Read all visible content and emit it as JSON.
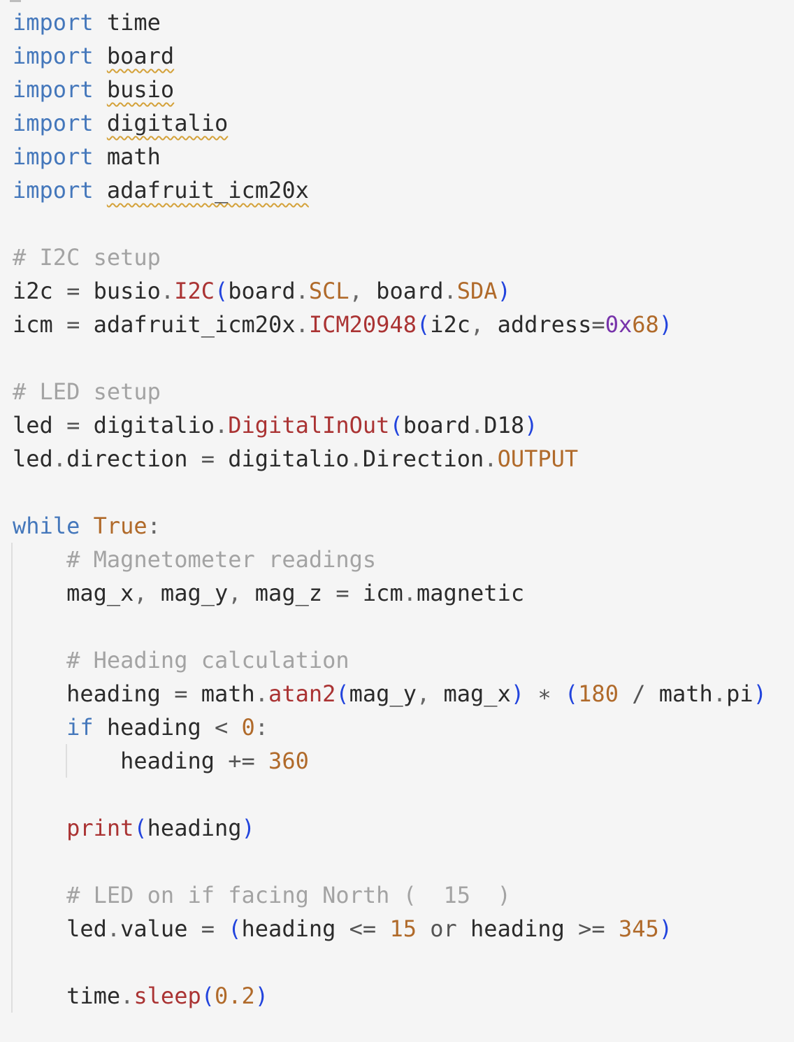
{
  "editor": {
    "language": "python",
    "colors": {
      "background": "#f5f5f5",
      "keyword": "#4477bb",
      "comment": "#a3a3a3",
      "attribute": "#b06a2a",
      "function": "#aa3333",
      "paren": "#2244dd",
      "number": "#b06a2a",
      "hex_prefix": "#7733aa",
      "squiggle_warning": "#d4a23a"
    },
    "lines": [
      {
        "tokens": [
          {
            "t": "import",
            "k": "kw"
          },
          {
            "t": " ",
            "k": "ident"
          },
          {
            "t": "time",
            "k": "ident"
          }
        ]
      },
      {
        "tokens": [
          {
            "t": "import",
            "k": "kw"
          },
          {
            "t": " ",
            "k": "ident"
          },
          {
            "t": "board",
            "k": "ident",
            "squig": true
          }
        ]
      },
      {
        "tokens": [
          {
            "t": "import",
            "k": "kw"
          },
          {
            "t": " ",
            "k": "ident"
          },
          {
            "t": "busio",
            "k": "ident",
            "squig": true
          }
        ]
      },
      {
        "tokens": [
          {
            "t": "import",
            "k": "kw"
          },
          {
            "t": " ",
            "k": "ident"
          },
          {
            "t": "digitalio",
            "k": "ident",
            "squig": true
          }
        ]
      },
      {
        "tokens": [
          {
            "t": "import",
            "k": "kw"
          },
          {
            "t": " ",
            "k": "ident"
          },
          {
            "t": "math",
            "k": "ident"
          }
        ]
      },
      {
        "tokens": [
          {
            "t": "import",
            "k": "kw"
          },
          {
            "t": " ",
            "k": "ident"
          },
          {
            "t": "adafruit_icm20x",
            "k": "ident",
            "squig": true
          }
        ]
      },
      {
        "tokens": []
      },
      {
        "tokens": [
          {
            "t": "# I2C setup",
            "k": "com"
          }
        ]
      },
      {
        "tokens": [
          {
            "t": "i2c ",
            "k": "ident"
          },
          {
            "t": "=",
            "k": "op"
          },
          {
            "t": " busio",
            "k": "ident"
          },
          {
            "t": ".",
            "k": "punc"
          },
          {
            "t": "I2C",
            "k": "func"
          },
          {
            "t": "(",
            "k": "paren"
          },
          {
            "t": "board",
            "k": "ident"
          },
          {
            "t": ".",
            "k": "punc"
          },
          {
            "t": "SCL",
            "k": "attr"
          },
          {
            "t": ", ",
            "k": "punc"
          },
          {
            "t": "board",
            "k": "ident"
          },
          {
            "t": ".",
            "k": "punc"
          },
          {
            "t": "SDA",
            "k": "attr"
          },
          {
            "t": ")",
            "k": "paren"
          }
        ]
      },
      {
        "tokens": [
          {
            "t": "icm ",
            "k": "ident"
          },
          {
            "t": "=",
            "k": "op"
          },
          {
            "t": " adafruit_icm20x",
            "k": "ident"
          },
          {
            "t": ".",
            "k": "punc"
          },
          {
            "t": "ICM20948",
            "k": "func"
          },
          {
            "t": "(",
            "k": "paren"
          },
          {
            "t": "i2c",
            "k": "ident"
          },
          {
            "t": ", ",
            "k": "punc"
          },
          {
            "t": "address",
            "k": "ident"
          },
          {
            "t": "=",
            "k": "op"
          },
          {
            "t": "0x",
            "k": "hex"
          },
          {
            "t": "68",
            "k": "num"
          },
          {
            "t": ")",
            "k": "paren"
          }
        ]
      },
      {
        "tokens": []
      },
      {
        "tokens": [
          {
            "t": "# LED setup",
            "k": "com"
          }
        ]
      },
      {
        "tokens": [
          {
            "t": "led ",
            "k": "ident"
          },
          {
            "t": "=",
            "k": "op"
          },
          {
            "t": " digitalio",
            "k": "ident"
          },
          {
            "t": ".",
            "k": "punc"
          },
          {
            "t": "DigitalInOut",
            "k": "func"
          },
          {
            "t": "(",
            "k": "paren"
          },
          {
            "t": "board",
            "k": "ident"
          },
          {
            "t": ".",
            "k": "punc"
          },
          {
            "t": "D18",
            "k": "ident"
          },
          {
            "t": ")",
            "k": "paren"
          }
        ]
      },
      {
        "tokens": [
          {
            "t": "led",
            "k": "ident"
          },
          {
            "t": ".",
            "k": "punc"
          },
          {
            "t": "direction ",
            "k": "ident"
          },
          {
            "t": "=",
            "k": "op"
          },
          {
            "t": " digitalio",
            "k": "ident"
          },
          {
            "t": ".",
            "k": "punc"
          },
          {
            "t": "Direction",
            "k": "ident"
          },
          {
            "t": ".",
            "k": "punc"
          },
          {
            "t": "OUTPUT",
            "k": "attr"
          }
        ]
      },
      {
        "tokens": []
      },
      {
        "tokens": [
          {
            "t": "while",
            "k": "kw"
          },
          {
            "t": " ",
            "k": "ident"
          },
          {
            "t": "True",
            "k": "attr"
          },
          {
            "t": ":",
            "k": "punc"
          }
        ]
      },
      {
        "tokens": [
          {
            "t": "    ",
            "k": "ident"
          },
          {
            "t": "# Magnetometer readings",
            "k": "com"
          }
        ]
      },
      {
        "tokens": [
          {
            "t": "    mag_x",
            "k": "ident"
          },
          {
            "t": ", ",
            "k": "punc"
          },
          {
            "t": "mag_y",
            "k": "ident"
          },
          {
            "t": ", ",
            "k": "punc"
          },
          {
            "t": "mag_z ",
            "k": "ident"
          },
          {
            "t": "=",
            "k": "op"
          },
          {
            "t": " icm",
            "k": "ident"
          },
          {
            "t": ".",
            "k": "punc"
          },
          {
            "t": "magnetic",
            "k": "ident"
          }
        ]
      },
      {
        "tokens": []
      },
      {
        "tokens": [
          {
            "t": "    ",
            "k": "ident"
          },
          {
            "t": "# Heading calculation",
            "k": "com"
          }
        ]
      },
      {
        "tokens": [
          {
            "t": "    heading ",
            "k": "ident"
          },
          {
            "t": "=",
            "k": "op"
          },
          {
            "t": " math",
            "k": "ident"
          },
          {
            "t": ".",
            "k": "punc"
          },
          {
            "t": "atan2",
            "k": "func"
          },
          {
            "t": "(",
            "k": "paren"
          },
          {
            "t": "mag_y",
            "k": "ident"
          },
          {
            "t": ", ",
            "k": "punc"
          },
          {
            "t": "mag_x",
            "k": "ident"
          },
          {
            "t": ")",
            "k": "paren"
          },
          {
            "t": " ∗ ",
            "k": "op"
          },
          {
            "t": "(",
            "k": "paren"
          },
          {
            "t": "180",
            "k": "num"
          },
          {
            "t": " / ",
            "k": "op"
          },
          {
            "t": "math",
            "k": "ident"
          },
          {
            "t": ".",
            "k": "punc"
          },
          {
            "t": "pi",
            "k": "ident"
          },
          {
            "t": ")",
            "k": "paren"
          }
        ]
      },
      {
        "tokens": [
          {
            "t": "    ",
            "k": "ident"
          },
          {
            "t": "if",
            "k": "kw"
          },
          {
            "t": " heading ",
            "k": "ident"
          },
          {
            "t": "<",
            "k": "op"
          },
          {
            "t": " ",
            "k": "ident"
          },
          {
            "t": "0",
            "k": "num"
          },
          {
            "t": ":",
            "k": "punc"
          }
        ]
      },
      {
        "tokens": [
          {
            "t": "        heading ",
            "k": "ident"
          },
          {
            "t": "+=",
            "k": "op"
          },
          {
            "t": " ",
            "k": "ident"
          },
          {
            "t": "360",
            "k": "num"
          }
        ]
      },
      {
        "tokens": []
      },
      {
        "tokens": [
          {
            "t": "    ",
            "k": "ident"
          },
          {
            "t": "print",
            "k": "func"
          },
          {
            "t": "(",
            "k": "paren"
          },
          {
            "t": "heading",
            "k": "ident"
          },
          {
            "t": ")",
            "k": "paren"
          }
        ]
      },
      {
        "tokens": []
      },
      {
        "tokens": [
          {
            "t": "    ",
            "k": "ident"
          },
          {
            "t": "# LED on if facing North (  15  )",
            "k": "com"
          }
        ]
      },
      {
        "tokens": [
          {
            "t": "    led",
            "k": "ident"
          },
          {
            "t": ".",
            "k": "punc"
          },
          {
            "t": "value ",
            "k": "ident"
          },
          {
            "t": "=",
            "k": "op"
          },
          {
            "t": " ",
            "k": "ident"
          },
          {
            "t": "(",
            "k": "paren"
          },
          {
            "t": "heading ",
            "k": "ident"
          },
          {
            "t": "<=",
            "k": "op"
          },
          {
            "t": " ",
            "k": "ident"
          },
          {
            "t": "15",
            "k": "num"
          },
          {
            "t": " or ",
            "k": "op"
          },
          {
            "t": "heading ",
            "k": "ident"
          },
          {
            "t": ">=",
            "k": "op"
          },
          {
            "t": " ",
            "k": "ident"
          },
          {
            "t": "345",
            "k": "num"
          },
          {
            "t": ")",
            "k": "paren"
          }
        ]
      },
      {
        "tokens": []
      },
      {
        "tokens": [
          {
            "t": "    time",
            "k": "ident"
          },
          {
            "t": ".",
            "k": "punc"
          },
          {
            "t": "sleep",
            "k": "func"
          },
          {
            "t": "(",
            "k": "paren"
          },
          {
            "t": "0.2",
            "k": "num"
          },
          {
            "t": ")",
            "k": "paren"
          }
        ]
      }
    ]
  }
}
